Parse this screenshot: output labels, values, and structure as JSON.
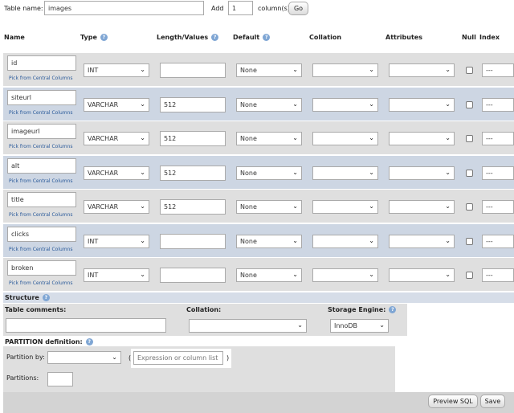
{
  "top": {
    "table_name_label": "Table name:",
    "table_name_value": "images",
    "add_label": "Add",
    "add_value": "1",
    "columns_label": "column(s)",
    "go_label": "Go"
  },
  "headers": {
    "name": "Name",
    "type": "Type",
    "length": "Length/Values",
    "default": "Default",
    "collation": "Collation",
    "attributes": "Attributes",
    "null": "Null",
    "index": "Index"
  },
  "pick_label": "Pick from Central Columns",
  "rows": [
    {
      "name": "id",
      "type": "INT",
      "length": "",
      "default": "None",
      "index": "---"
    },
    {
      "name": "siteurl",
      "type": "VARCHAR",
      "length": "512",
      "default": "None",
      "index": "---"
    },
    {
      "name": "imageurl",
      "type": "VARCHAR",
      "length": "512",
      "default": "None",
      "index": "---"
    },
    {
      "name": "alt",
      "type": "VARCHAR",
      "length": "512",
      "default": "None",
      "index": "---"
    },
    {
      "name": "title",
      "type": "VARCHAR",
      "length": "512",
      "default": "None",
      "index": "---"
    },
    {
      "name": "clicks",
      "type": "INT",
      "length": "",
      "default": "None",
      "index": "---"
    },
    {
      "name": "broken",
      "type": "INT",
      "length": "",
      "default": "None",
      "index": "---"
    }
  ],
  "structure": {
    "title": "Structure",
    "table_comments_label": "Table comments:",
    "table_comments_value": "",
    "collation_label": "Collation:",
    "collation_value": "",
    "storage_engine_label": "Storage Engine:",
    "storage_engine_value": "InnoDB"
  },
  "partition": {
    "title": "PARTITION definition:",
    "partition_by_label": "Partition by:",
    "open_paren": "(",
    "close_paren": ")",
    "expression_placeholder": "Expression or column list",
    "partitions_label": "Partitions:"
  },
  "footer": {
    "preview_sql_label": "Preview SQL",
    "save_label": "Save"
  },
  "colors": {
    "row_odd": "#dfdfdf",
    "row_even": "#cdd6e3",
    "section_bar": "#d6dde8",
    "help_icon": "#7fa6d4",
    "link": "#2a5a9a"
  }
}
